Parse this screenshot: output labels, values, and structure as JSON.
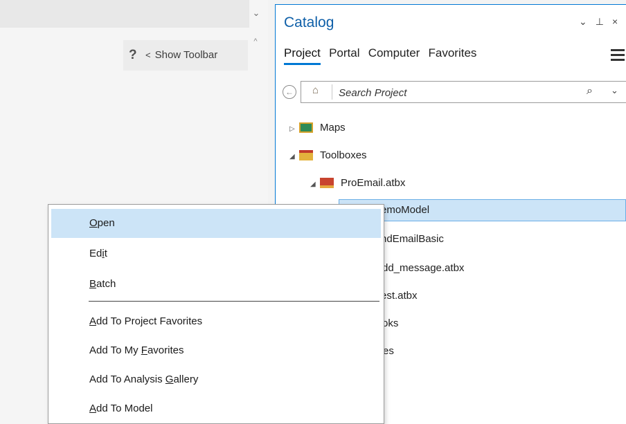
{
  "left_pane": {
    "help_glyph": "?",
    "show_toolbar_caret": "<",
    "show_toolbar_label": "Show Toolbar",
    "chevron": "⌄",
    "scroll_up": "^"
  },
  "catalog": {
    "title": "Catalog",
    "controls": [
      "⌄",
      "⊥",
      "×"
    ],
    "tabs": [
      {
        "label": "Project",
        "active": true
      },
      {
        "label": "Portal",
        "active": false
      },
      {
        "label": "Computer",
        "active": false
      },
      {
        "label": "Favorites",
        "active": false
      }
    ],
    "search": {
      "placeholder": "Search Project",
      "search_glyph": "⌕",
      "dropdown_glyph": "⌄",
      "back_glyph": "←",
      "home_glyph": "⌂"
    },
    "tree": [
      {
        "label": "Maps",
        "expander": "▷",
        "icon": "maps-icon"
      },
      {
        "label": "Toolboxes",
        "expander": "◢",
        "icon": "toolboxes-icon"
      },
      {
        "label": "ProEmail.atbx",
        "expander": "◢",
        "icon": "toolbox-icon"
      },
      {
        "label": "emoModel",
        "selected": true
      },
      {
        "label": "ndEmailBasic"
      },
      {
        "label": "dd_message.atbx"
      },
      {
        "label": "est.atbx"
      },
      {
        "label": "oks"
      },
      {
        "label": "es"
      }
    ]
  },
  "context_menu": {
    "items": [
      {
        "pre": "",
        "ul": "O",
        "post": "pen",
        "highlighted": true
      },
      {
        "pre": "Ed",
        "ul": "i",
        "post": "t"
      },
      {
        "pre": "",
        "ul": "B",
        "post": "atch"
      },
      {
        "pre": "",
        "ul": "A",
        "post": "dd To Project Favorites"
      },
      {
        "pre": "Add To My ",
        "ul": "F",
        "post": "avorites"
      },
      {
        "pre": "Add To Analysis ",
        "ul": "G",
        "post": "allery"
      },
      {
        "pre": "",
        "ul": "A",
        "post": "dd To Model"
      }
    ]
  },
  "colors": {
    "accent": "#0078d4",
    "selection": "#cce4f7",
    "title_blue": "#0e5fa8"
  }
}
